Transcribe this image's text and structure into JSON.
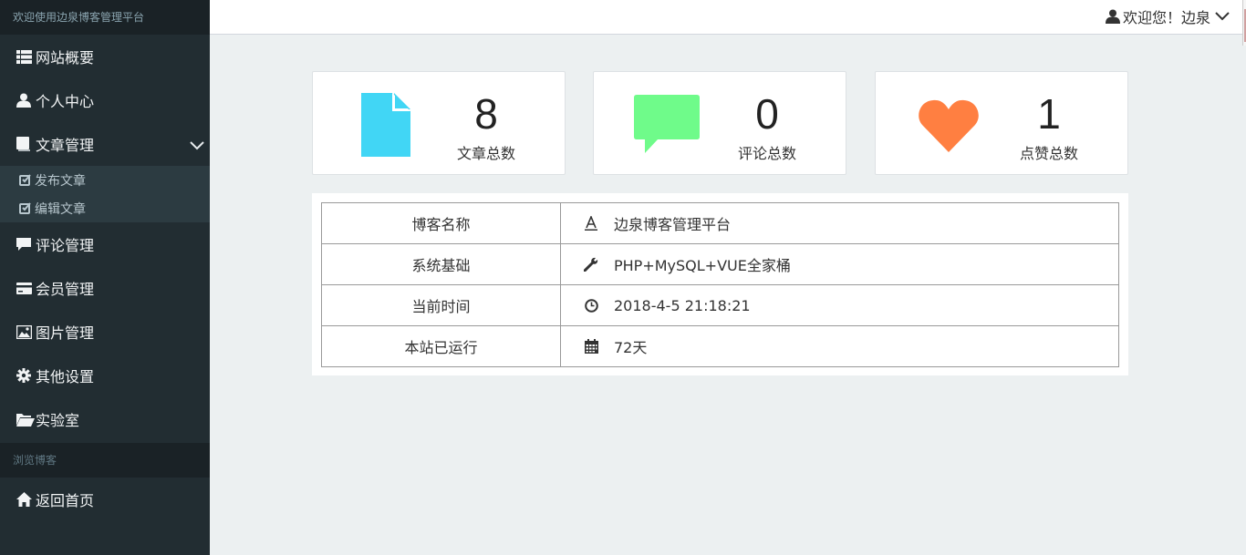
{
  "sidebar": {
    "header": "欢迎使用边泉博客管理平台",
    "items": [
      {
        "label": "网站概要",
        "icon": "th-list-icon"
      },
      {
        "label": "个人中心",
        "icon": "user-icon"
      },
      {
        "label": "文章管理",
        "icon": "book-icon",
        "expanded": true
      },
      {
        "label": "评论管理",
        "icon": "comment-icon"
      },
      {
        "label": "会员管理",
        "icon": "credit-card-icon"
      },
      {
        "label": "图片管理",
        "icon": "picture-icon"
      },
      {
        "label": "其他设置",
        "icon": "gear-icon"
      },
      {
        "label": "实验室",
        "icon": "folder-open-icon"
      }
    ],
    "submenu": [
      {
        "label": "发布文章",
        "icon": "edit-icon"
      },
      {
        "label": "编辑文章",
        "icon": "edit-icon"
      }
    ],
    "section_label": "浏览博客",
    "home_item": {
      "label": "返回首页",
      "icon": "home-icon"
    }
  },
  "topbar": {
    "user_greeting": "欢迎您！边泉"
  },
  "stats": [
    {
      "value": "8",
      "label": "文章总数",
      "icon": "file-icon",
      "color": "#41d6f5"
    },
    {
      "value": "0",
      "label": "评论总数",
      "icon": "comment-icon",
      "color": "#6ffb8a"
    },
    {
      "value": "1",
      "label": "点赞总数",
      "icon": "heart-icon",
      "color": "#ff7f41"
    }
  ],
  "info": {
    "rows": [
      {
        "key": "博客名称",
        "icon": "font-icon",
        "value": "边泉博客管理平台"
      },
      {
        "key": "系统基础",
        "icon": "wrench-icon",
        "value": "PHP+MySQL+VUE全家桶"
      },
      {
        "key": "当前时间",
        "icon": "clock-icon",
        "value": "2018-4-5 21:18:21"
      },
      {
        "key": "本站已运行",
        "icon": "calendar-icon",
        "value": "72天"
      }
    ]
  }
}
